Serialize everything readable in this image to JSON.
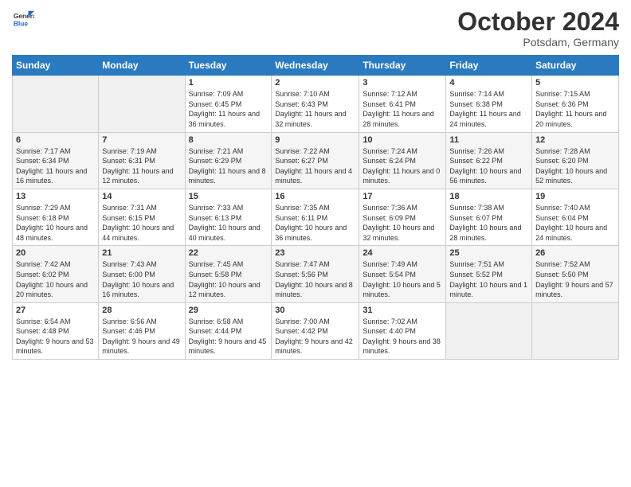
{
  "logo": {
    "general": "General",
    "blue": "Blue"
  },
  "header": {
    "month": "October 2024",
    "location": "Potsdam, Germany"
  },
  "weekdays": [
    "Sunday",
    "Monday",
    "Tuesday",
    "Wednesday",
    "Thursday",
    "Friday",
    "Saturday"
  ],
  "weeks": [
    [
      null,
      null,
      {
        "day": "1",
        "sunrise": "7:09 AM",
        "sunset": "6:45 PM",
        "daylight": "11 hours and 36 minutes."
      },
      {
        "day": "2",
        "sunrise": "7:10 AM",
        "sunset": "6:43 PM",
        "daylight": "11 hours and 32 minutes."
      },
      {
        "day": "3",
        "sunrise": "7:12 AM",
        "sunset": "6:41 PM",
        "daylight": "11 hours and 28 minutes."
      },
      {
        "day": "4",
        "sunrise": "7:14 AM",
        "sunset": "6:38 PM",
        "daylight": "11 hours and 24 minutes."
      },
      {
        "day": "5",
        "sunrise": "7:15 AM",
        "sunset": "6:36 PM",
        "daylight": "11 hours and 20 minutes."
      }
    ],
    [
      {
        "day": "6",
        "sunrise": "7:17 AM",
        "sunset": "6:34 PM",
        "daylight": "11 hours and 16 minutes."
      },
      {
        "day": "7",
        "sunrise": "7:19 AM",
        "sunset": "6:31 PM",
        "daylight": "11 hours and 12 minutes."
      },
      {
        "day": "8",
        "sunrise": "7:21 AM",
        "sunset": "6:29 PM",
        "daylight": "11 hours and 8 minutes."
      },
      {
        "day": "9",
        "sunrise": "7:22 AM",
        "sunset": "6:27 PM",
        "daylight": "11 hours and 4 minutes."
      },
      {
        "day": "10",
        "sunrise": "7:24 AM",
        "sunset": "6:24 PM",
        "daylight": "11 hours and 0 minutes."
      },
      {
        "day": "11",
        "sunrise": "7:26 AM",
        "sunset": "6:22 PM",
        "daylight": "10 hours and 56 minutes."
      },
      {
        "day": "12",
        "sunrise": "7:28 AM",
        "sunset": "6:20 PM",
        "daylight": "10 hours and 52 minutes."
      }
    ],
    [
      {
        "day": "13",
        "sunrise": "7:29 AM",
        "sunset": "6:18 PM",
        "daylight": "10 hours and 48 minutes."
      },
      {
        "day": "14",
        "sunrise": "7:31 AM",
        "sunset": "6:15 PM",
        "daylight": "10 hours and 44 minutes."
      },
      {
        "day": "15",
        "sunrise": "7:33 AM",
        "sunset": "6:13 PM",
        "daylight": "10 hours and 40 minutes."
      },
      {
        "day": "16",
        "sunrise": "7:35 AM",
        "sunset": "6:11 PM",
        "daylight": "10 hours and 36 minutes."
      },
      {
        "day": "17",
        "sunrise": "7:36 AM",
        "sunset": "6:09 PM",
        "daylight": "10 hours and 32 minutes."
      },
      {
        "day": "18",
        "sunrise": "7:38 AM",
        "sunset": "6:07 PM",
        "daylight": "10 hours and 28 minutes."
      },
      {
        "day": "19",
        "sunrise": "7:40 AM",
        "sunset": "6:04 PM",
        "daylight": "10 hours and 24 minutes."
      }
    ],
    [
      {
        "day": "20",
        "sunrise": "7:42 AM",
        "sunset": "6:02 PM",
        "daylight": "10 hours and 20 minutes."
      },
      {
        "day": "21",
        "sunrise": "7:43 AM",
        "sunset": "6:00 PM",
        "daylight": "10 hours and 16 minutes."
      },
      {
        "day": "22",
        "sunrise": "7:45 AM",
        "sunset": "5:58 PM",
        "daylight": "10 hours and 12 minutes."
      },
      {
        "day": "23",
        "sunrise": "7:47 AM",
        "sunset": "5:56 PM",
        "daylight": "10 hours and 8 minutes."
      },
      {
        "day": "24",
        "sunrise": "7:49 AM",
        "sunset": "5:54 PM",
        "daylight": "10 hours and 5 minutes."
      },
      {
        "day": "25",
        "sunrise": "7:51 AM",
        "sunset": "5:52 PM",
        "daylight": "10 hours and 1 minute."
      },
      {
        "day": "26",
        "sunrise": "7:52 AM",
        "sunset": "5:50 PM",
        "daylight": "9 hours and 57 minutes."
      }
    ],
    [
      {
        "day": "27",
        "sunrise": "6:54 AM",
        "sunset": "4:48 PM",
        "daylight": "9 hours and 53 minutes."
      },
      {
        "day": "28",
        "sunrise": "6:56 AM",
        "sunset": "4:46 PM",
        "daylight": "9 hours and 49 minutes."
      },
      {
        "day": "29",
        "sunrise": "6:58 AM",
        "sunset": "4:44 PM",
        "daylight": "9 hours and 45 minutes."
      },
      {
        "day": "30",
        "sunrise": "7:00 AM",
        "sunset": "4:42 PM",
        "daylight": "9 hours and 42 minutes."
      },
      {
        "day": "31",
        "sunrise": "7:02 AM",
        "sunset": "4:40 PM",
        "daylight": "9 hours and 38 minutes."
      },
      null,
      null
    ]
  ]
}
